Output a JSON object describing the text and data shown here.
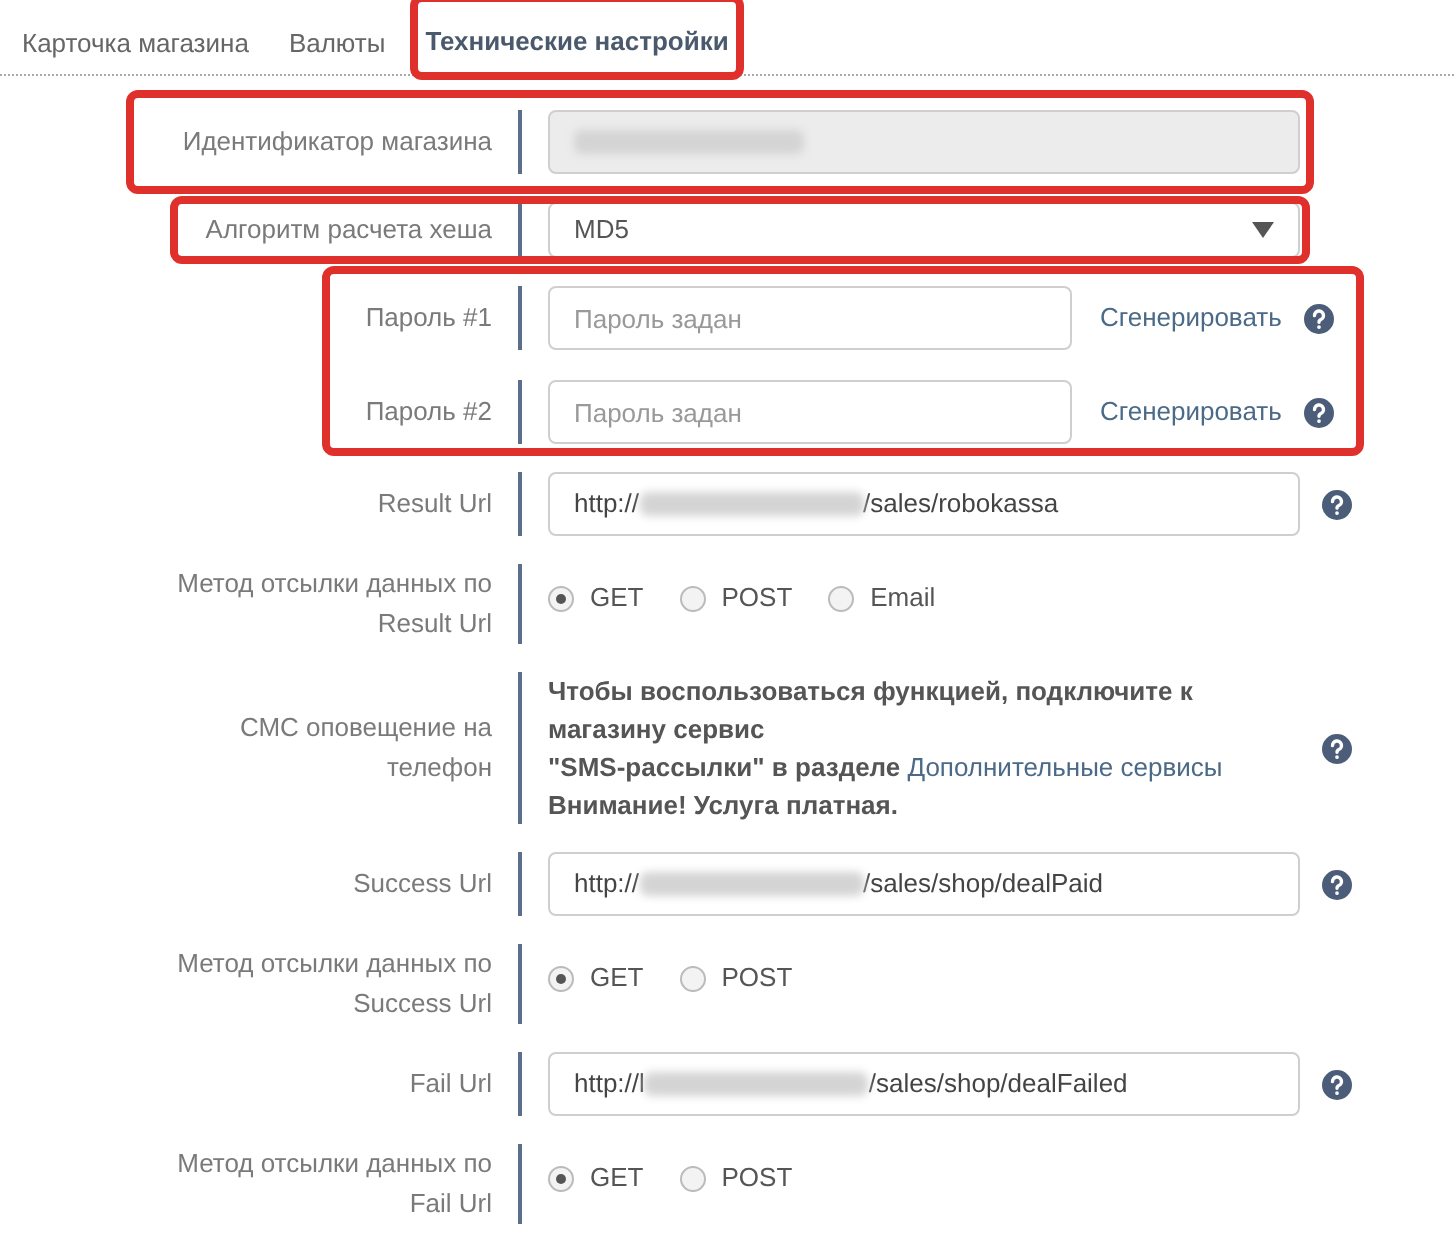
{
  "tabs": [
    {
      "label": "Карточка магазина",
      "selected": false,
      "highlighted": false
    },
    {
      "label": "Валюты",
      "selected": false,
      "highlighted": false
    },
    {
      "label": "Технические настройки",
      "selected": true,
      "highlighted": true
    }
  ],
  "rows": [
    {
      "kind": "readonly",
      "label": "Идентификатор магазина",
      "redacted": true,
      "highlighted": true
    },
    {
      "kind": "select",
      "label": "Алгоритм расчета хеша",
      "value": "MD5",
      "highlighted": true
    },
    {
      "kind": "password_group",
      "highlighted": true,
      "items": [
        {
          "label": "Пароль #1",
          "placeholder": "Пароль задан",
          "action": "Сгенерировать"
        },
        {
          "label": "Пароль #2",
          "placeholder": "Пароль задан",
          "action": "Сгенерировать"
        }
      ]
    },
    {
      "kind": "url",
      "label": "Result Url",
      "prefix": "http://",
      "suffix": "/sales/robokassa",
      "redacted": true
    },
    {
      "kind": "radio",
      "label": "Метод отсылки данных по Result Url",
      "options": [
        {
          "label": "GET",
          "selected": true
        },
        {
          "label": "POST",
          "selected": false
        },
        {
          "label": "Email",
          "selected": false
        }
      ]
    },
    {
      "kind": "notice",
      "label": "СМС оповещение на телефон",
      "lines": [
        "Чтобы воспользоваться функцией, подключите к магазину сервис",
        "\"SMS-рассылки\" в разделе"
      ],
      "link": "Дополнительные сервисы",
      "note": "Внимание! Услуга платная."
    },
    {
      "kind": "url",
      "label": "Success Url",
      "prefix": "http://",
      "suffix": "/sales/shop/dealPaid",
      "redacted": true
    },
    {
      "kind": "radio",
      "label": "Метод отсылки данных по Success Url",
      "options": [
        {
          "label": "GET",
          "selected": true
        },
        {
          "label": "POST",
          "selected": false
        }
      ]
    },
    {
      "kind": "url",
      "label": "Fail Url",
      "prefix": "http://l",
      "suffix": "/sales/shop/dealFailed",
      "redacted": true
    },
    {
      "kind": "radio",
      "label": "Метод отсылки данных по Fail Url",
      "options": [
        {
          "label": "GET",
          "selected": true
        },
        {
          "label": "POST",
          "selected": false
        }
      ]
    }
  ]
}
